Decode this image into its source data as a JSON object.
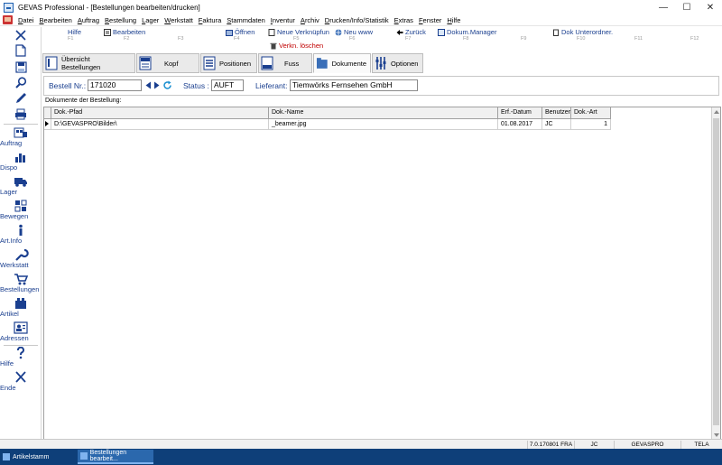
{
  "window": {
    "title": "GEVAS Professional - [Bestellungen bearbeiten/drucken]",
    "minimize": "—",
    "maximize": "☐",
    "close": "✕"
  },
  "menu": [
    "Datei",
    "Bearbeiten",
    "Auftrag",
    "Bestellung",
    "Lager",
    "Werkstatt",
    "Faktura",
    "Stammdaten",
    "Inventur",
    "Archiv",
    "Drucken/Info/Statistik",
    "Extras",
    "Fenster",
    "Hilfe"
  ],
  "sidebar": {
    "items": [
      {
        "label": "Auftrag",
        "icon": "order-icon"
      },
      {
        "label": "Dispo",
        "icon": "chart-icon"
      },
      {
        "label": "Lager",
        "icon": "truck-icon"
      },
      {
        "label": "Bewegen",
        "icon": "move-icon"
      },
      {
        "label": "Art.Info",
        "icon": "info-icon"
      },
      {
        "label": "Werkstatt",
        "icon": "wrench-icon"
      },
      {
        "label": "Bestellungen",
        "icon": "cart-icon"
      },
      {
        "label": "Artikel",
        "icon": "box-icon"
      },
      {
        "label": "Adressen",
        "icon": "contact-icon"
      }
    ],
    "help": "Hilfe",
    "end": "Ende"
  },
  "fkeys": {
    "hilfe": "Hilfe",
    "bearbeiten": "Bearbeiten",
    "oeffnen": "Öffnen",
    "neue_verknuepfung": "Neue Verknüpfun",
    "neu_www": "Neu www",
    "zurueck": "Zurück",
    "dokum_manager": "Dokum.Manager",
    "dok_unterordner": "Dok Unterordner.",
    "verkn_loeschen": "Verkn. löschen",
    "numbers": [
      "F1",
      "F2",
      "F3",
      "F4",
      "F5",
      "F6",
      "F7",
      "F8",
      "F9",
      "F10",
      "F11",
      "F12"
    ]
  },
  "tabs": [
    {
      "label": "Übersicht Bestellungen"
    },
    {
      "label": "Kopf"
    },
    {
      "label": "Positionen"
    },
    {
      "label": "Fuss"
    },
    {
      "label": "Dokumente"
    },
    {
      "label": "Optionen"
    }
  ],
  "header": {
    "bestell_label": "Bestell Nr.:",
    "bestell_value": "171020",
    "status_label": "Status :",
    "status_value": "AUFT",
    "lieferant_label": "Lieferant:",
    "lieferant_value": "Tiemwörks Fernsehen GmbH"
  },
  "documents": {
    "section_label": "Dokumente der Bestellung:",
    "columns": [
      "Dok.-Pfad",
      "Dok.-Name",
      "Erf.-Datum",
      "Benutzer",
      "Dok.-Art"
    ],
    "rows": [
      [
        "D:\\GEVASPRO\\Bilder\\",
        "_beamer.jpg",
        "01.08.2017",
        "JC",
        "1"
      ]
    ]
  },
  "statusbar": {
    "version": "7.0.170801 FRA",
    "user": "JC",
    "db": "GEVASPRO",
    "company": "TELA"
  },
  "taskbar": {
    "items": [
      "Artikelstamm",
      "Bestellungen bearbeit..."
    ]
  }
}
